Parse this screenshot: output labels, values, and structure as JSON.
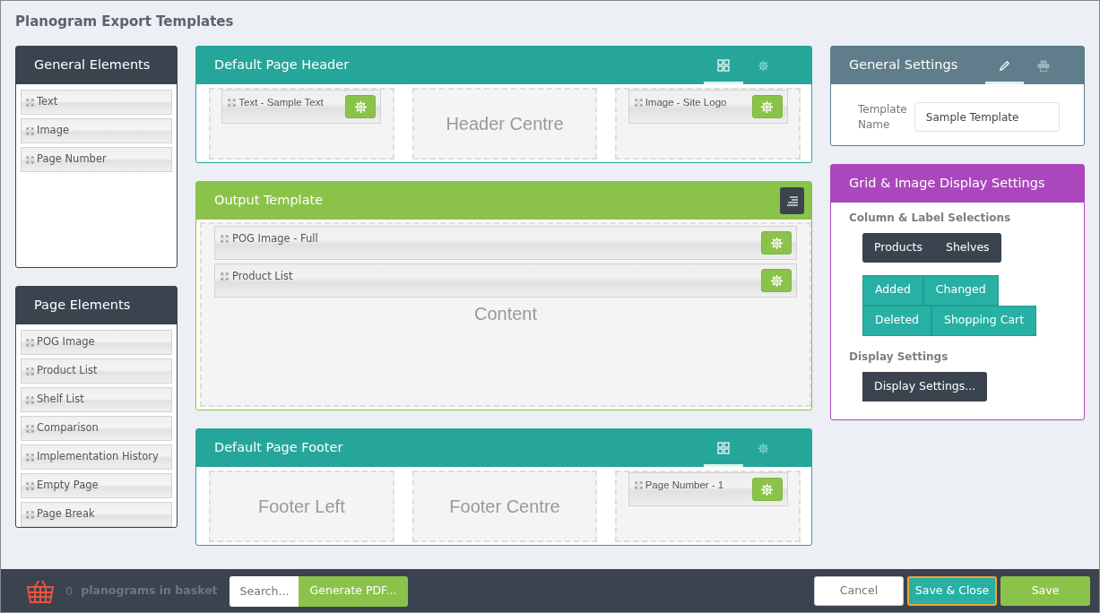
{
  "page_title": "Planogram Export Templates",
  "palettes": [
    {
      "title": "General Elements",
      "items": [
        "Text",
        "Image",
        "Page Number"
      ]
    },
    {
      "title": "Page Elements",
      "items": [
        "POG Image",
        "Product List",
        "Shelf List",
        "Comparison",
        "Implementation History",
        "Empty Page",
        "Page Break"
      ]
    }
  ],
  "sections": [
    {
      "kind": "band",
      "title": "Default Page Header",
      "tabs": [
        {
          "selected": true
        },
        {
          "selected": false
        }
      ],
      "zones": [
        {
          "element": "Text - Sample Text"
        },
        {
          "label": "Header Centre"
        },
        {
          "element": "Image - Site Logo"
        }
      ]
    },
    {
      "kind": "content",
      "title": "Output Template",
      "items": [
        "POG Image - Full",
        "Product List"
      ],
      "label": "Content"
    },
    {
      "kind": "band",
      "title": "Default Page Footer",
      "tabs": [
        {
          "selected": true
        },
        {
          "selected": false
        }
      ],
      "zones": [
        {
          "label": "Footer Left"
        },
        {
          "label": "Footer Centre"
        },
        {
          "element": "Page Number - 1"
        }
      ]
    }
  ],
  "general_settings": {
    "title": "General Settings",
    "tabs": [
      {
        "selected": true
      },
      {
        "selected": false
      }
    ],
    "field_label": "Template Name",
    "field_value": "Sample Template"
  },
  "grid_settings": {
    "title": "Grid & Image Display Settings",
    "groups": [
      {
        "heading": "Column & Label Selections",
        "button_sets": [
          {
            "kind": "dark",
            "rows": [
              [
                "Products",
                "Shelves"
              ]
            ]
          },
          {
            "kind": "teal",
            "rows": [
              [
                "Added",
                "Changed"
              ],
              [
                "Deleted",
                "Shopping Cart"
              ]
            ]
          }
        ]
      },
      {
        "heading": "Display Settings",
        "button_sets": [
          {
            "kind": "dark",
            "rows": [
              [
                "Display Settings..."
              ]
            ]
          }
        ]
      }
    ]
  },
  "bottom_bar": {
    "basket_count": "0",
    "basket_label": "planograms in basket",
    "search_placeholder": "Search...",
    "generate": "Generate PDF...",
    "buttons": [
      {
        "label": "Cancel",
        "kind": "light",
        "focused": false
      },
      {
        "label": "Save & Close",
        "kind": "teal",
        "focused": true
      },
      {
        "label": "Save",
        "kind": "green",
        "focused": false
      }
    ]
  }
}
